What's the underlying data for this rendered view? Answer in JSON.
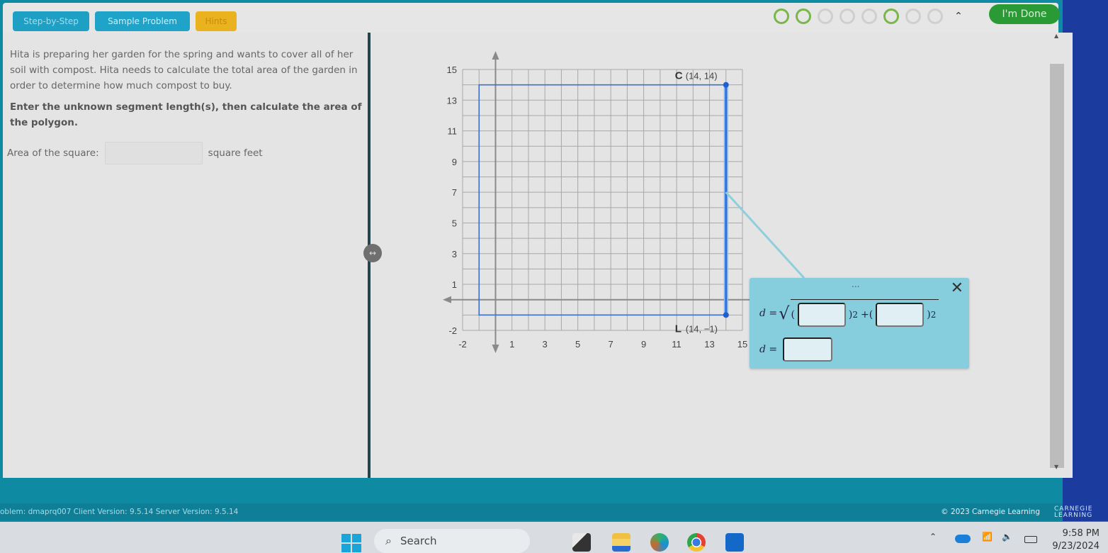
{
  "toolbar": {
    "step_by_step": "Step-by-Step",
    "sample_problem": "Sample Problem",
    "hints": "Hints",
    "done": "I'm Done",
    "progress": [
      {
        "state": "complete"
      },
      {
        "state": "complete"
      },
      {
        "state": "incomplete"
      },
      {
        "state": "incomplete"
      },
      {
        "state": "incomplete"
      },
      {
        "state": "complete"
      },
      {
        "state": "incomplete"
      },
      {
        "state": "incomplete"
      }
    ],
    "collapse_icon": "chevron-up-icon"
  },
  "problem": {
    "intro": "Hita is preparing her garden for the spring and wants to cover all of her soil with compost. Hita needs to calculate the total area of the garden in order to determine how much compost to buy.",
    "instruction": "Enter the unknown segment length(s), then calculate the area of the polygon.",
    "area_label": "Area of the square:",
    "area_value": "",
    "area_unit": "square feet"
  },
  "graph": {
    "x_range": [
      -2,
      15
    ],
    "y_range": [
      -2,
      15
    ],
    "x_ticks": [
      "-2",
      "1",
      "3",
      "5",
      "7",
      "9",
      "11",
      "13",
      "15"
    ],
    "y_ticks": [
      "15",
      "13",
      "11",
      "9",
      "7",
      "5",
      "3",
      "1",
      "-2"
    ],
    "polygon": [
      [
        -1,
        14
      ],
      [
        14,
        14
      ],
      [
        14,
        -1
      ],
      [
        -1,
        -1
      ]
    ],
    "points": [
      {
        "name": "C",
        "label": "(14, 14)",
        "x": 14,
        "y": 14
      },
      {
        "name": "L",
        "label": "(14, −1)",
        "x": 14,
        "y": -1
      }
    ],
    "highlight_segment": "CL",
    "colors": {
      "polygon": "#3b6fd0",
      "highlight": "#7fb0f0",
      "grid": "#a8a8a8"
    }
  },
  "distance_popup": {
    "menu_icon": "...",
    "formula_lhs": "d =",
    "open_paren": "(",
    "close_sq": ")",
    "plus": "+",
    "exponent": "2",
    "input1": "",
    "input2": "",
    "result_label": "d =",
    "result_value": ""
  },
  "footer": {
    "version_info": "oblem: dmaprq007   Client Version: 9.5.14   Server Version: 9.5.14",
    "copyright": "© 2023 Carnegie Learning",
    "brand_line1": "CARNEGIE",
    "brand_line2": "LEARNING"
  },
  "taskbar": {
    "search_placeholder": "Search",
    "time": "9:58 PM",
    "date": "9/23/2024"
  }
}
